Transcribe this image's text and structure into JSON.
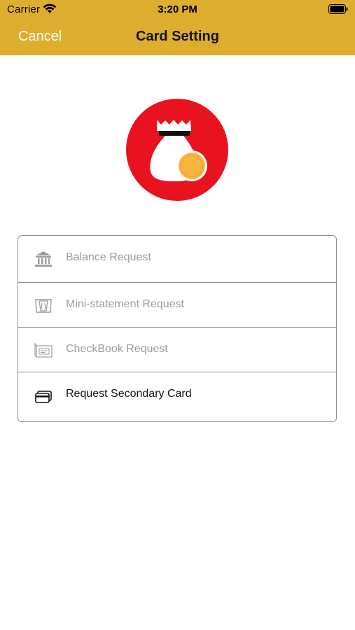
{
  "status_bar": {
    "carrier": "Carrier",
    "time": "3:20 PM"
  },
  "nav": {
    "cancel_label": "Cancel",
    "title": "Card Setting"
  },
  "menu": {
    "items": [
      {
        "label": "Balance Request",
        "icon": "bank-icon",
        "enabled": false
      },
      {
        "label": "Mini-statement Request",
        "icon": "atm-icon",
        "enabled": false
      },
      {
        "label": "CheckBook Request",
        "icon": "checkbook-icon",
        "enabled": false
      },
      {
        "label": "Request Secondary Card",
        "icon": "card-icon",
        "enabled": true
      }
    ]
  },
  "colors": {
    "header": "#DDAD2F",
    "logo_circle": "#E8131F",
    "coin": "#F8B63F",
    "disabled_text": "#9C9C9C",
    "enabled_text": "#111111"
  }
}
